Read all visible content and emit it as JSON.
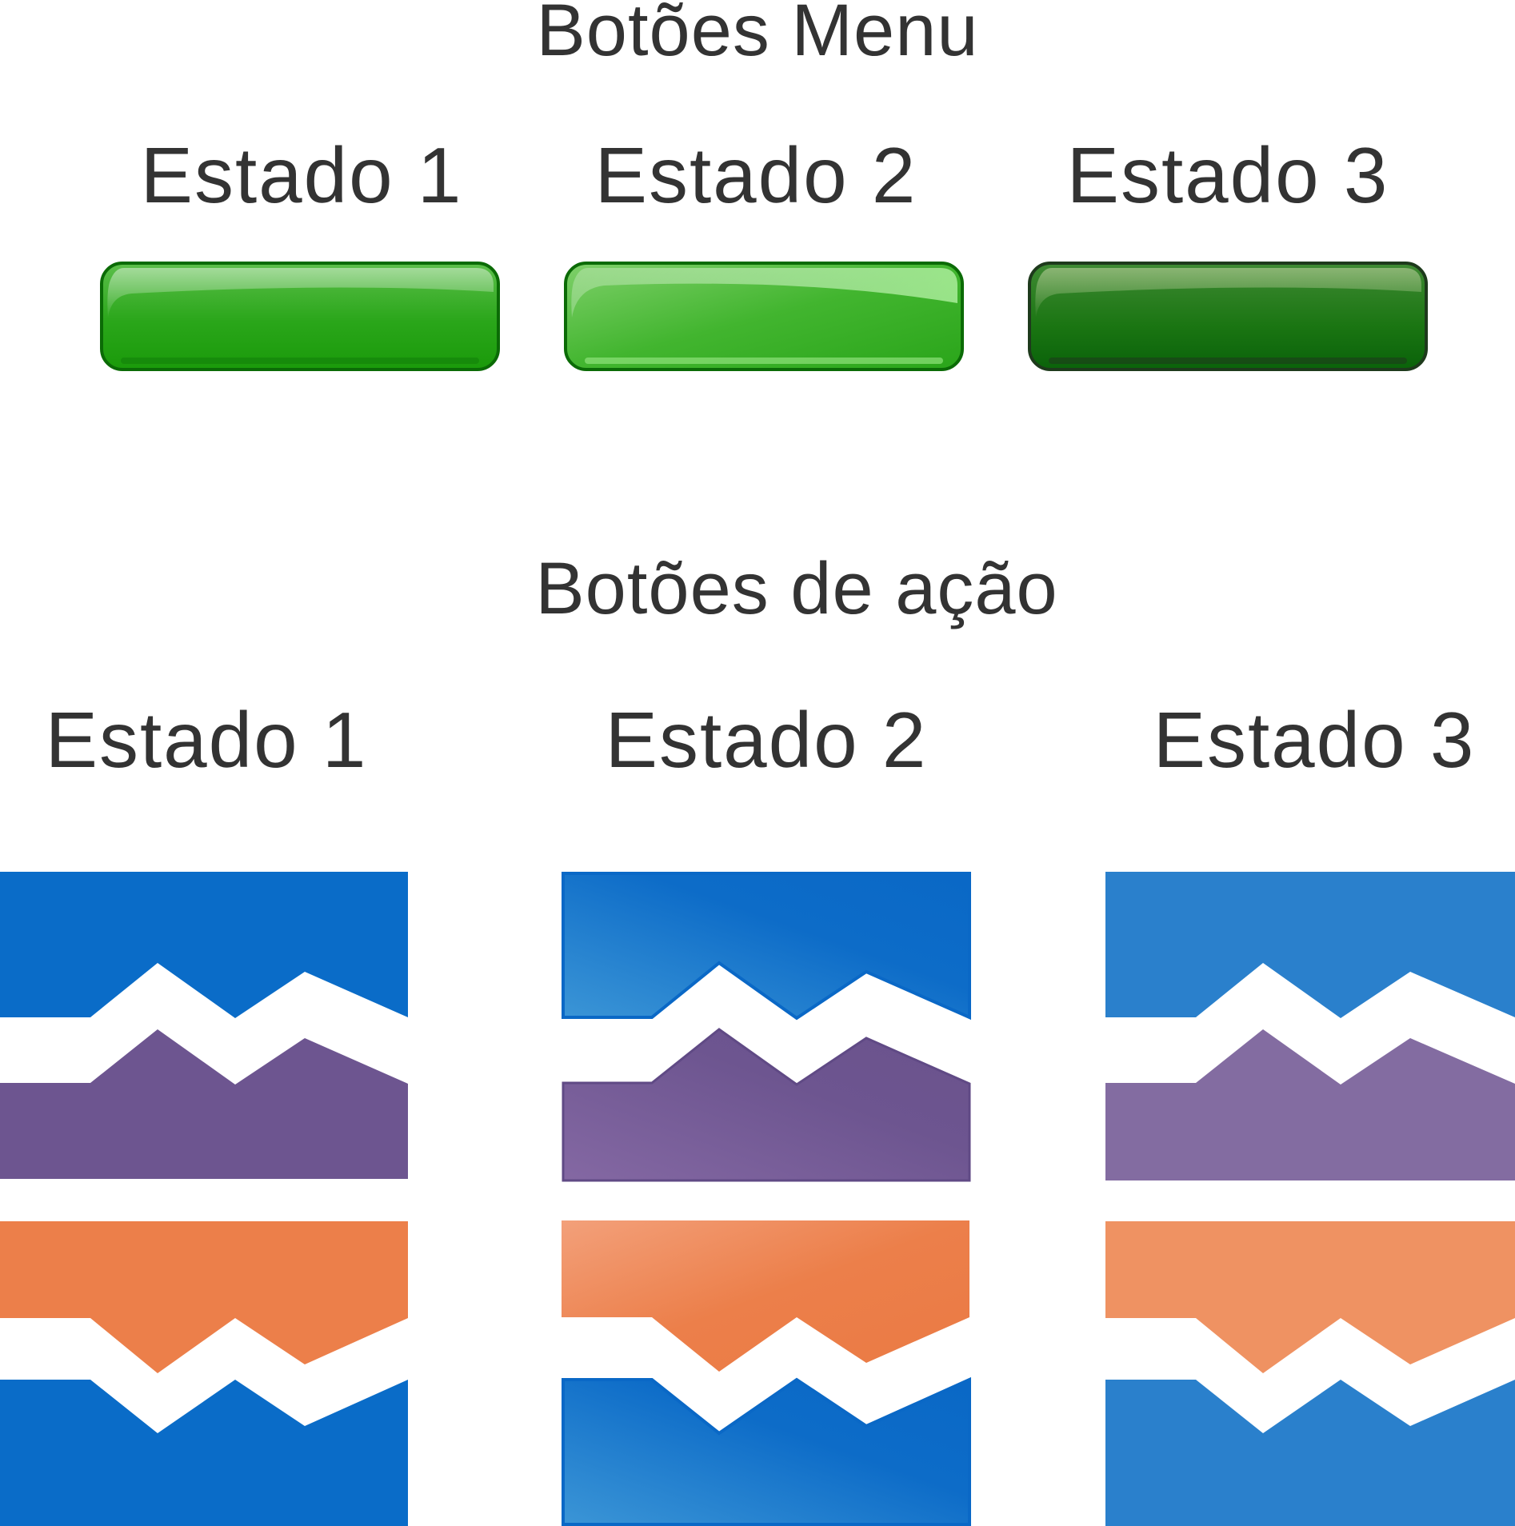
{
  "menu_section": {
    "title": "Botões Menu",
    "states": [
      {
        "label": "Estado 1"
      },
      {
        "label": "Estado 2"
      },
      {
        "label": "Estado 3"
      }
    ]
  },
  "action_section": {
    "title": "Botões de ação",
    "states": [
      {
        "label": "Estado 1"
      },
      {
        "label": "Estado 2"
      },
      {
        "label": "Estado 3"
      }
    ]
  },
  "colors": {
    "text": "#333333",
    "menu_green_normal": "#22a012",
    "menu_green_hover": "#4cbf3a",
    "menu_green_pressed": "#0e6b0a",
    "action_blue": "#0a6cc8",
    "action_purple": "#6d5590",
    "action_orange": "#ec7f4a"
  }
}
